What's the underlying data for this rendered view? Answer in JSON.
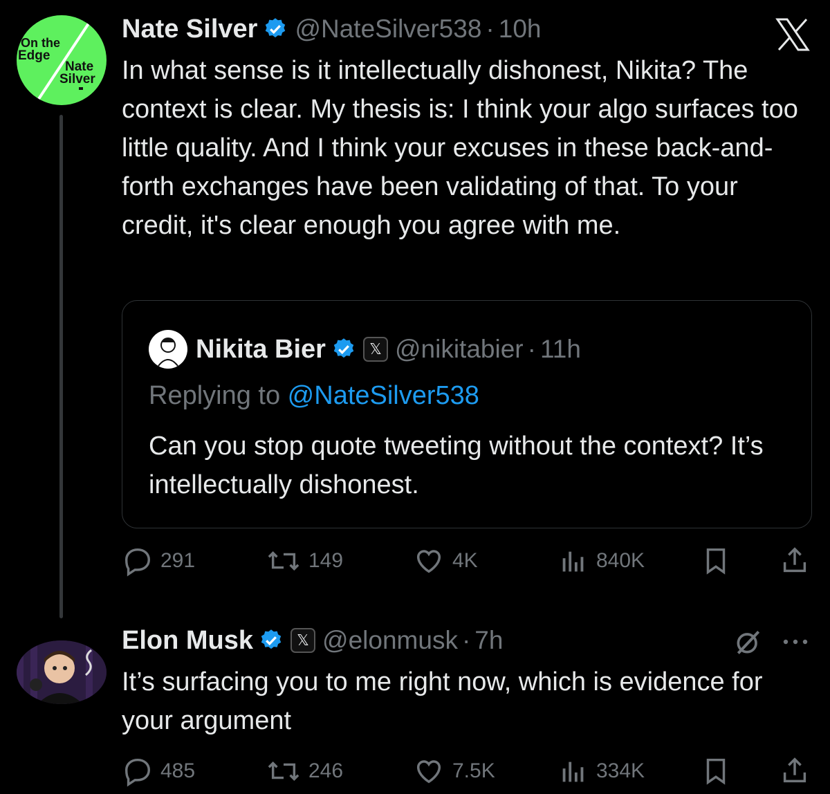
{
  "post1": {
    "author_name": "Nate Silver",
    "handle": "@NateSilver538",
    "separator": "·",
    "time": "10h",
    "text": "In what sense is it intellectually dishonest, Nikita? The context is clear. My thesis is: I think your algo surfaces too little quality. And I think your excuses in these back-and-forth exchanges have been validating of that. To your credit, it's clear enough you agree with me.",
    "avatar_text": {
      "line1": "On the",
      "line2": "Edge",
      "line3": "Nate",
      "line4": "Silver"
    },
    "quote": {
      "author_name": "Nikita Bier",
      "handle": "@nikitabier",
      "separator": "·",
      "time": "11h",
      "replying_prefix": "Replying to ",
      "replying_to": "@NateSilver538",
      "text": "Can you stop quote tweeting without the context? It’s intellectually dishonest."
    },
    "actions": {
      "replies": "291",
      "reposts": "149",
      "likes": "4K",
      "views": "840K"
    }
  },
  "post2": {
    "author_name": "Elon Musk",
    "handle": "@elonmusk",
    "separator": "·",
    "time": "7h",
    "text": "It’s surfacing you to me right now, which is evidence for your argument",
    "actions": {
      "replies": "485",
      "reposts": "246",
      "likes": "7.5K",
      "views": "334K"
    }
  },
  "colors": {
    "background": "#000000",
    "text": "#e7e9ea",
    "muted": "#71767b",
    "accent": "#1d9bf0",
    "verified": "#1d9bf0"
  }
}
